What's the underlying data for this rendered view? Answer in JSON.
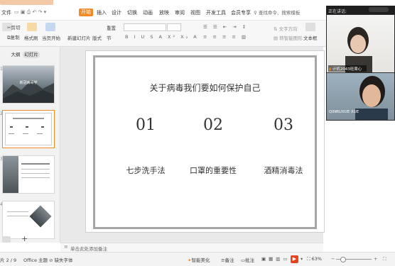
{
  "titlebar": {
    "doc_tab": ""
  },
  "menu": {
    "file": "文件",
    "items": [
      "开始",
      "插入",
      "设计",
      "切换",
      "动画",
      "放映",
      "审阅",
      "视图",
      "开发工具",
      "会员专享"
    ],
    "search": "查找命令、搜索模板"
  },
  "ribbon": {
    "cut": "剪切",
    "copy": "复制",
    "format_painter": "格式刷",
    "from_current": "当页开始",
    "new_slide": "新建幻灯片",
    "layout": "版式",
    "section": "节",
    "reset": "重置",
    "textbox": "文本框",
    "textbox2": "文本框"
  },
  "left_panel": {
    "tab_outline": "大纲",
    "tab_slides": "幻灯片",
    "thumb1_title": "新冠病毒学",
    "slide_numbers": [
      "1",
      "2",
      "3",
      "4"
    ]
  },
  "slide": {
    "title": "关于病毒我们要如何保护自己",
    "items": [
      {
        "num": "01",
        "label": "七步洗手法"
      },
      {
        "num": "02",
        "label": "口罩的重要性"
      },
      {
        "num": "03",
        "label": "酒精消毒法"
      }
    ]
  },
  "notes": {
    "placeholder": "单击此处添加备注"
  },
  "status": {
    "page": "片 2 / 9",
    "theme": "Office 主题",
    "font_missing": "缺失字体",
    "smart_beautify": "智能美化",
    "notes": "备注",
    "comments": "批注",
    "zoom": "63%"
  },
  "call": {
    "header": "正在讲话:",
    "user1_name": "计机2043班周心",
    "user2_name": "QINRUXUE XUE"
  },
  "colors": {
    "accent": "#f08a24",
    "ribbon_bg": "#f7f7f7",
    "slide_border": "#a6a6a6"
  }
}
